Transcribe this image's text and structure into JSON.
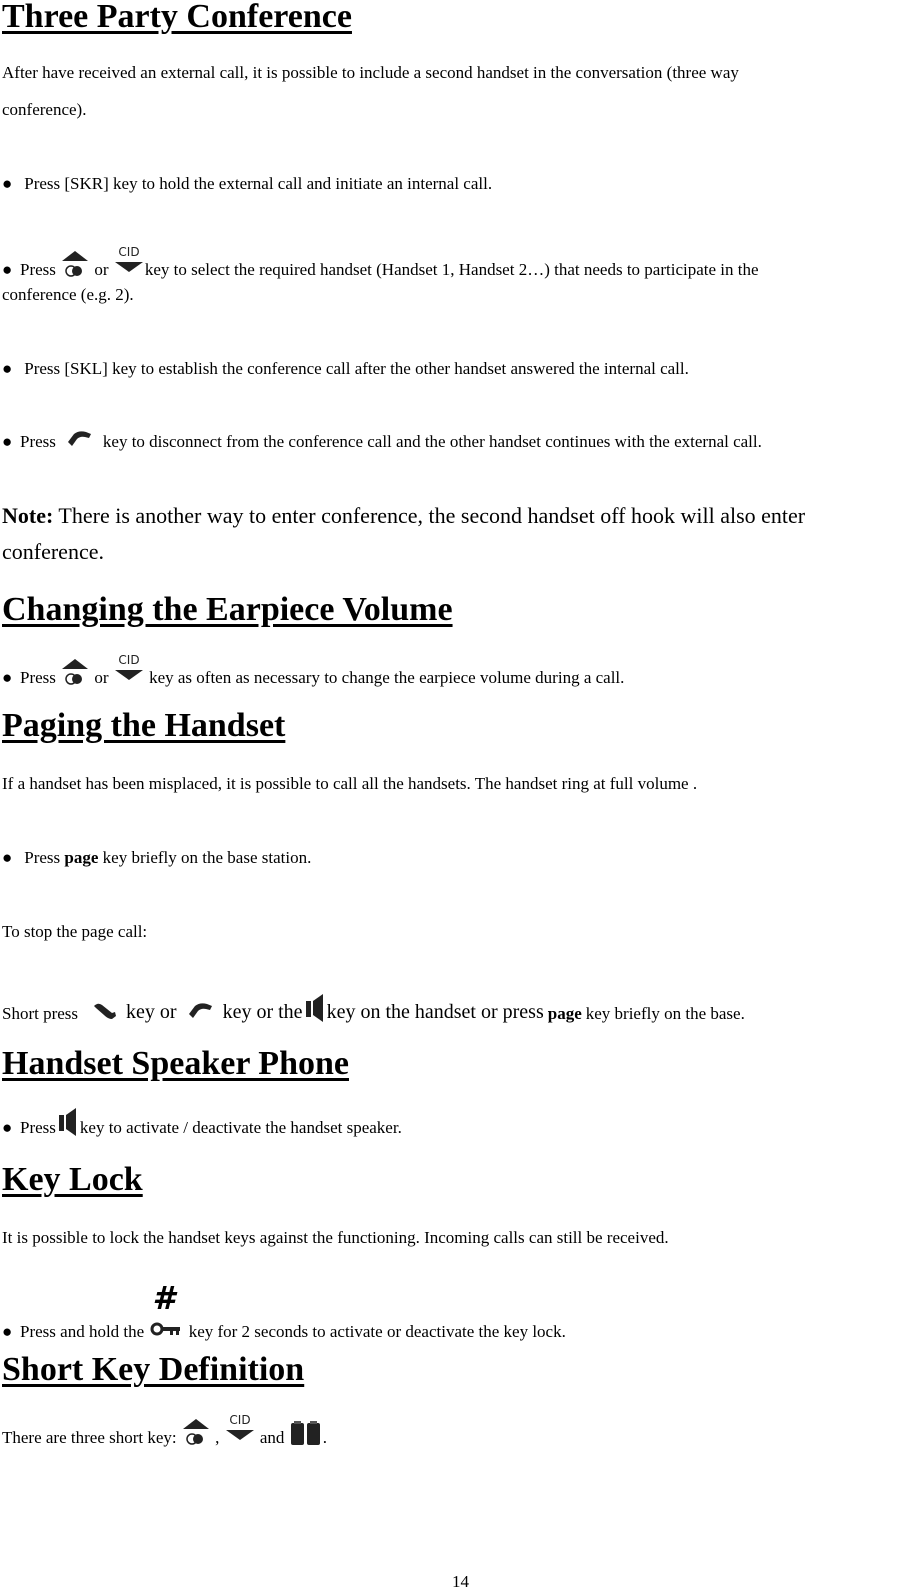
{
  "page_number": "14",
  "sections": {
    "three_party": {
      "title": "Three Party Conference",
      "intro_line1": "After have received an external call, it is possible to include a second handset in the conversation (three way",
      "intro_line2": "conference).",
      "bullet1": "Press [SKR] key to hold the external call and initiate an internal call.",
      "bullet2_prefix": "Press",
      "bullet2_or": "or",
      "bullet2_suffix": "key to select the required handset (Handset 1, Handset 2…) that needs to participate in the",
      "bullet2_line2": "conference (e.g. 2).",
      "bullet3": "Press [SKL] key to establish the conference call after the other handset answered the internal call.",
      "bullet4_prefix": "Press",
      "bullet4_suffix": "key to disconnect from the conference call and the other handset continues with the external call.",
      "note_label": "Note:",
      "note_line1": " There is another way to enter conference, the second  handset off hook will also enter",
      "note_line2": "conference."
    },
    "earpiece": {
      "title": "Changing the Earpiece Volume",
      "bullet_prefix": "Press",
      "bullet_or": "or",
      "bullet_suffix": "key as often as necessary to change the earpiece volume during a call."
    },
    "paging": {
      "title": "Paging the Handset",
      "intro": "If a handset has been misplaced, it is possible to call all the handsets. The handset ring at full volume .",
      "bullet_prefix": "Press",
      "bullet_kw": "page",
      "bullet_suffix": " key briefly on the base station.",
      "stop_label": "To stop the page call:",
      "short_press": "Short press",
      "key_or": "key or",
      "key_or_the": "key or the",
      "key_on_handset": "key on the handset or press",
      "page_kw": "page",
      "key_briefly": "key briefly on the base."
    },
    "speaker": {
      "title": "Handset Speaker Phone",
      "bullet_prefix": "Press",
      "bullet_suffix": "key to activate / deactivate the handset speaker."
    },
    "keylock": {
      "title": "Key Lock",
      "intro": "It is possible to lock the handset keys against the functioning. Incoming calls can still be received.",
      "bullet_prefix": "Press and hold the",
      "bullet_suffix": "key for 2 seconds to activate or deactivate the key lock.",
      "hash_symbol": "#"
    },
    "shortkey": {
      "title": "Short Key Definition",
      "text_prefix": "There are three short key:",
      "comma": ",",
      "and": "and",
      "period": "."
    }
  },
  "bullet_glyph": "●",
  "icons": {
    "cid_label": "CID"
  }
}
